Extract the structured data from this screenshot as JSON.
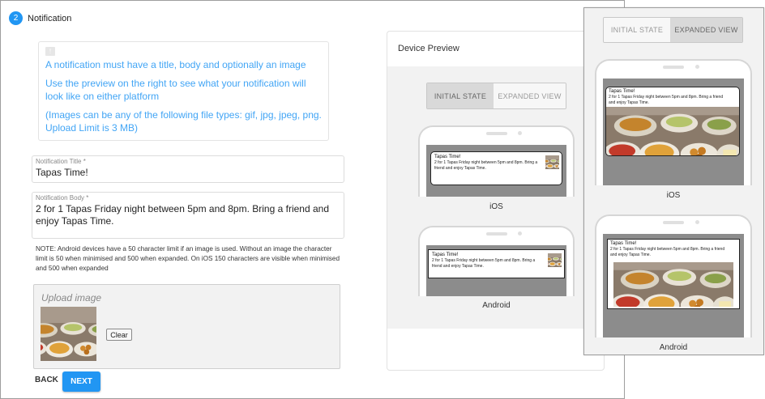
{
  "step": {
    "number": "2",
    "title": "Notification"
  },
  "info": {
    "icon": "info-icon",
    "lines": [
      "A notification must have a title, body and optionally an image",
      "Use the preview on the right to see what your notification will look like on either platform",
      "(Images can be any of the following file types: gif, jpg, jpeg, png. Upload Limit is 3 MB)"
    ]
  },
  "form": {
    "title_label": "Notification Title *",
    "title_value": "Tapas Time!",
    "body_label": "Notification Body *",
    "body_value": "2 for 1 Tapas Friday night between 5pm and 8pm. Bring a friend and enjoy Tapas Time.",
    "note": "NOTE: Android devices have a 50 character limit if an image is used. Without an image the character limit is 50 when minimised and 500 when expanded. On iOS 150 characters are visible when minimised and 500 when expanded"
  },
  "upload": {
    "label": "Upload image",
    "clear_label": "Clear"
  },
  "nav": {
    "back_label": "BACK",
    "next_label": "NEXT"
  },
  "preview": {
    "title": "Device Preview",
    "toggle": {
      "initial": "INITIAL STATE",
      "expanded": "EXPANDED VIEW"
    },
    "ios_label": "iOS",
    "android_label": "Android",
    "notif_title": "Tapas Time!",
    "notif_body": "2 for 1 Tapas Friday night between 5pm and 8pm. Bring a friend and enjoy Tapas Time."
  },
  "colors": {
    "accent": "#2196f3",
    "info_text": "#42a5f5",
    "preview_bg": "#f2f2f2",
    "screen_gray": "#8c8c8c"
  }
}
